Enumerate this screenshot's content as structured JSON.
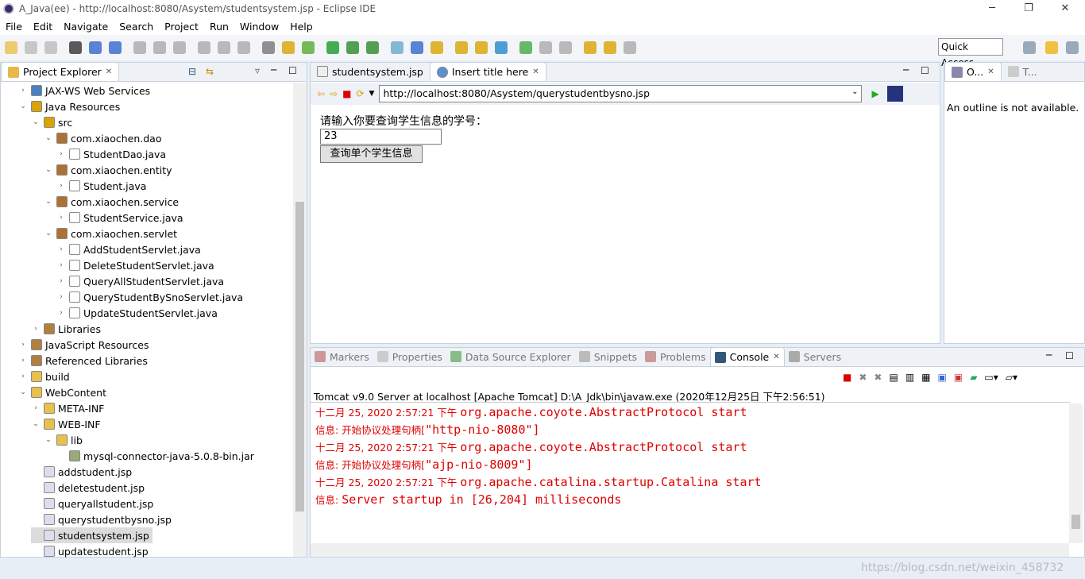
{
  "window": {
    "title": "A_Java(ee) - http://localhost:8080/Asystem/studentsystem.jsp - Eclipse IDE",
    "minimize": "─",
    "restore": "❐",
    "close": "✕"
  },
  "menu": [
    "File",
    "Edit",
    "Navigate",
    "Search",
    "Project",
    "Run",
    "Window",
    "Help"
  ],
  "quick_access": "Quick Access",
  "project_explorer": {
    "title": "Project Explorer",
    "items": [
      {
        "label": "JAX-WS Web Services",
        "level": 1,
        "icon": "webservice",
        "tw": "›"
      },
      {
        "label": "Java Resources",
        "level": 1,
        "icon": "java-resources",
        "tw": "⌄"
      },
      {
        "label": "src",
        "level": 2,
        "icon": "src-folder",
        "tw": "⌄"
      },
      {
        "label": "com.xiaochen.dao",
        "level": 3,
        "icon": "package",
        "tw": "⌄"
      },
      {
        "label": "StudentDao.java",
        "level": 4,
        "icon": "java-file",
        "tw": "›"
      },
      {
        "label": "com.xiaochen.entity",
        "level": 3,
        "icon": "package",
        "tw": "⌄"
      },
      {
        "label": "Student.java",
        "level": 4,
        "icon": "java-file",
        "tw": "›"
      },
      {
        "label": "com.xiaochen.service",
        "level": 3,
        "icon": "package",
        "tw": "⌄"
      },
      {
        "label": "StudentService.java",
        "level": 4,
        "icon": "java-file",
        "tw": "›"
      },
      {
        "label": "com.xiaochen.servlet",
        "level": 3,
        "icon": "package",
        "tw": "⌄"
      },
      {
        "label": "AddStudentServlet.java",
        "level": 4,
        "icon": "java-file",
        "tw": "›"
      },
      {
        "label": "DeleteStudentServlet.java",
        "level": 4,
        "icon": "java-file",
        "tw": "›"
      },
      {
        "label": "QueryAllStudentServlet.java",
        "level": 4,
        "icon": "java-file",
        "tw": "›"
      },
      {
        "label": "QueryStudentBySnoServlet.java",
        "level": 4,
        "icon": "java-file",
        "tw": "›"
      },
      {
        "label": "UpdateStudentServlet.java",
        "level": 4,
        "icon": "java-file",
        "tw": "›"
      },
      {
        "label": "Libraries",
        "level": 2,
        "icon": "library",
        "tw": "›"
      },
      {
        "label": "JavaScript Resources",
        "level": 1,
        "icon": "library",
        "tw": "›"
      },
      {
        "label": "Referenced Libraries",
        "level": 1,
        "icon": "library",
        "tw": "›"
      },
      {
        "label": "build",
        "level": 1,
        "icon": "folder",
        "tw": "›"
      },
      {
        "label": "WebContent",
        "level": 1,
        "icon": "folder",
        "tw": "⌄"
      },
      {
        "label": "META-INF",
        "level": 2,
        "icon": "folder",
        "tw": "›"
      },
      {
        "label": "WEB-INF",
        "level": 2,
        "icon": "folder",
        "tw": "⌄"
      },
      {
        "label": "lib",
        "level": 3,
        "icon": "folder",
        "tw": "⌄"
      },
      {
        "label": "mysql-connector-java-5.0.8-bin.jar",
        "level": 4,
        "icon": "jar",
        "tw": ""
      },
      {
        "label": "addstudent.jsp",
        "level": 2,
        "icon": "jsp-file",
        "tw": ""
      },
      {
        "label": "deletestudent.jsp",
        "level": 2,
        "icon": "jsp-file",
        "tw": ""
      },
      {
        "label": "queryallstudent.jsp",
        "level": 2,
        "icon": "jsp-file",
        "tw": ""
      },
      {
        "label": "querystudentbysno.jsp",
        "level": 2,
        "icon": "jsp-file",
        "tw": ""
      },
      {
        "label": "studentsystem.jsp",
        "level": 2,
        "icon": "jsp-file",
        "tw": "",
        "selected": true
      },
      {
        "label": "updatestudent.jsp",
        "level": 2,
        "icon": "jsp-file",
        "tw": ""
      }
    ]
  },
  "editor": {
    "tabs": [
      {
        "label": "studentsystem.jsp",
        "active": false
      },
      {
        "label": "Insert title here",
        "active": true
      }
    ],
    "url": "http://localhost:8080/Asystem/querystudentbysno.jsp",
    "page": {
      "prompt": "请输入你要查询学生信息的学号：",
      "input_value": "23",
      "button": "查询单个学生信息"
    }
  },
  "outline": {
    "tabs": [
      "O...",
      "T..."
    ],
    "message": "An outline is not available."
  },
  "bottom": {
    "tabs": [
      "Markers",
      "Properties",
      "Data Source Explorer",
      "Snippets",
      "Problems",
      "Console",
      "Servers"
    ],
    "active": "Console",
    "console_header": "Tomcat v9.0 Server at localhost [Apache Tomcat] D:\\A_Jdk\\bin\\javaw.exe (2020年12月25日 下午2:56:51)",
    "lines": [
      {
        "prefix": "十二月 25, 2020 2:57:21 下午 ",
        "text": "org.apache.coyote.AbstractProtocol start"
      },
      {
        "prefix": "信息: 开始协议处理句柄[",
        "text": "\"http-nio-8080\"]"
      },
      {
        "prefix": "十二月 25, 2020 2:57:21 下午 ",
        "text": "org.apache.coyote.AbstractProtocol start"
      },
      {
        "prefix": "信息: 开始协议处理句柄[",
        "text": "\"ajp-nio-8009\"]"
      },
      {
        "prefix": "十二月 25, 2020 2:57:21 下午 ",
        "text": "org.apache.catalina.startup.Catalina start"
      },
      {
        "prefix": "信息: ",
        "text": "Server startup in [26,204] milliseconds"
      }
    ],
    "color": "#e00000"
  },
  "watermark": "https://blog.csdn.net/weixin_458732"
}
